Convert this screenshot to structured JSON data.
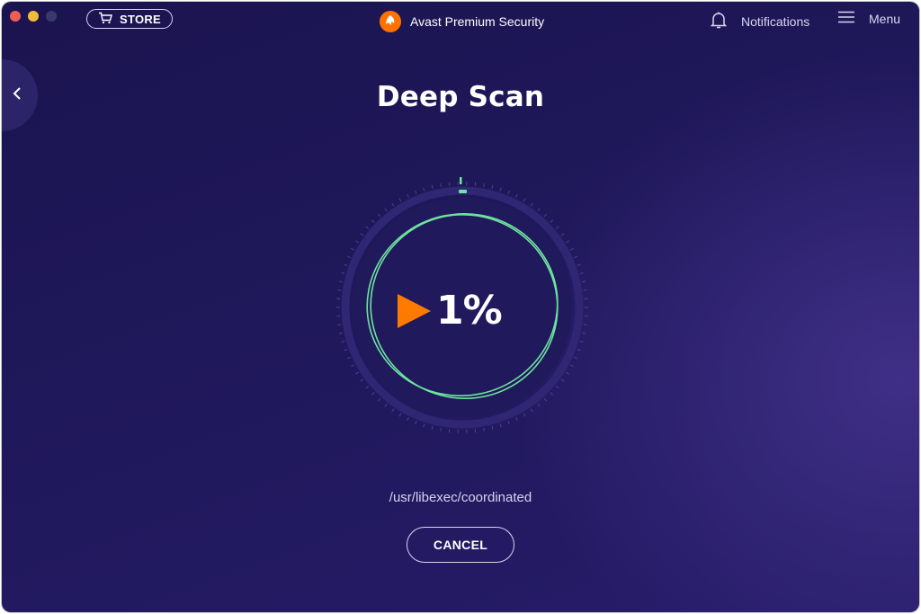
{
  "window": {
    "title": "Avast Premium Security"
  },
  "toolbar": {
    "store_label": "STORE",
    "notifications_label": "Notifications",
    "menu_label": "Menu"
  },
  "icons": {
    "store": "cart-icon",
    "logo": "avast-logo-icon",
    "notifications": "bell-icon",
    "menu": "hamburger-icon",
    "back": "chevron-left-icon",
    "scan": "play-icon"
  },
  "scan": {
    "title": "Deep Scan",
    "progress_text": "1%",
    "progress_value": 0.01,
    "current_file": "/usr/libexec/coordinated",
    "cancel_label": "CANCEL"
  },
  "colors": {
    "accent_orange": "#ff7a00",
    "progress_green": "#6fe3a0",
    "background": "#1f185a"
  }
}
